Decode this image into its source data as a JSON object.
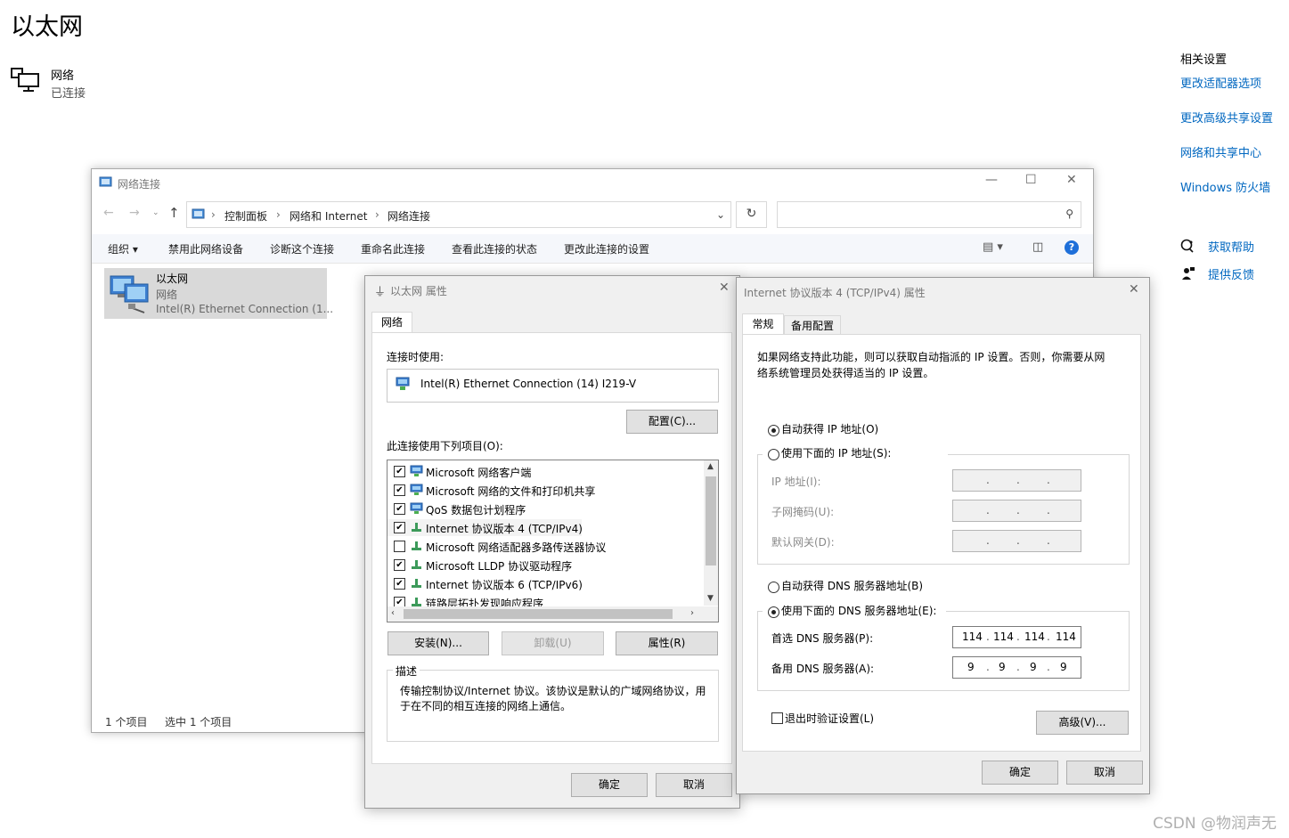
{
  "settings": {
    "title": "以太网",
    "network_name": "网络",
    "network_status": "已连接",
    "related_title": "相关设置",
    "related_links": [
      "更改适配器选项",
      "更改高级共享设置",
      "网络和共享中心",
      "Windows 防火墙"
    ],
    "help": "获取帮助",
    "feedback": "提供反馈"
  },
  "watermark": "CSDN @物润声无",
  "explorer": {
    "title": "网络连接",
    "breadcrumb": [
      "控制面板",
      "网络和 Internet",
      "网络连接"
    ],
    "commands": [
      "组织 ▾",
      "禁用此网络设备",
      "诊断这个连接",
      "重命名此连接",
      "查看此连接的状态",
      "更改此连接的设置"
    ],
    "item": {
      "name": "以太网",
      "type": "网络",
      "adapter": "Intel(R) Ethernet Connection (1..."
    },
    "status_count": "1 个项目",
    "status_selected": "选中 1 个项目"
  },
  "props": {
    "title": "以太网 属性",
    "tab": "网络",
    "connect_using_label": "连接时使用:",
    "adapter": "Intel(R) Ethernet Connection (14) I219-V",
    "configure": "配置(C)...",
    "items_label": "此连接使用下列项目(O):",
    "items": [
      {
        "label": "Microsoft 网络客户端",
        "checked": true
      },
      {
        "label": "Microsoft 网络的文件和打印机共享",
        "checked": true
      },
      {
        "label": "QoS 数据包计划程序",
        "checked": true
      },
      {
        "label": "Internet 协议版本 4 (TCP/IPv4)",
        "checked": true
      },
      {
        "label": "Microsoft 网络适配器多路传送器协议",
        "checked": false
      },
      {
        "label": "Microsoft LLDP 协议驱动程序",
        "checked": true
      },
      {
        "label": "Internet 协议版本 6 (TCP/IPv6)",
        "checked": true
      },
      {
        "label": "链路层拓扑发现响应程序",
        "checked": true
      }
    ],
    "install": "安装(N)...",
    "uninstall": "卸载(U)",
    "properties": "属性(R)",
    "desc_label": "描述",
    "desc_text": "传输控制协议/Internet 协议。该协议是默认的广域网络协议，用于在不同的相互连接的网络上通信。",
    "ok": "确定",
    "cancel": "取消"
  },
  "ipv4": {
    "title": "Internet 协议版本 4 (TCP/IPv4) 属性",
    "tabs": [
      "常规",
      "备用配置"
    ],
    "intro": "如果网络支持此功能，则可以获取自动指派的 IP 设置。否则，你需要从网络系统管理员处获得适当的 IP 设置。",
    "auto_ip": "自动获得 IP 地址(O)",
    "manual_ip": "使用下面的 IP 地址(S):",
    "ip_label": "IP 地址(I):",
    "mask_label": "子网掩码(U):",
    "gateway_label": "默认网关(D):",
    "auto_dns": "自动获得 DNS 服务器地址(B)",
    "manual_dns": "使用下面的 DNS 服务器地址(E):",
    "pref_dns_label": "首选 DNS 服务器(P):",
    "alt_dns_label": "备用 DNS 服务器(A):",
    "pref_dns": [
      "114",
      "114",
      "114",
      "114"
    ],
    "alt_dns": [
      "9",
      "9",
      "9",
      "9"
    ],
    "validate": "退出时验证设置(L)",
    "advanced": "高级(V)...",
    "ok": "确定",
    "cancel": "取消"
  }
}
